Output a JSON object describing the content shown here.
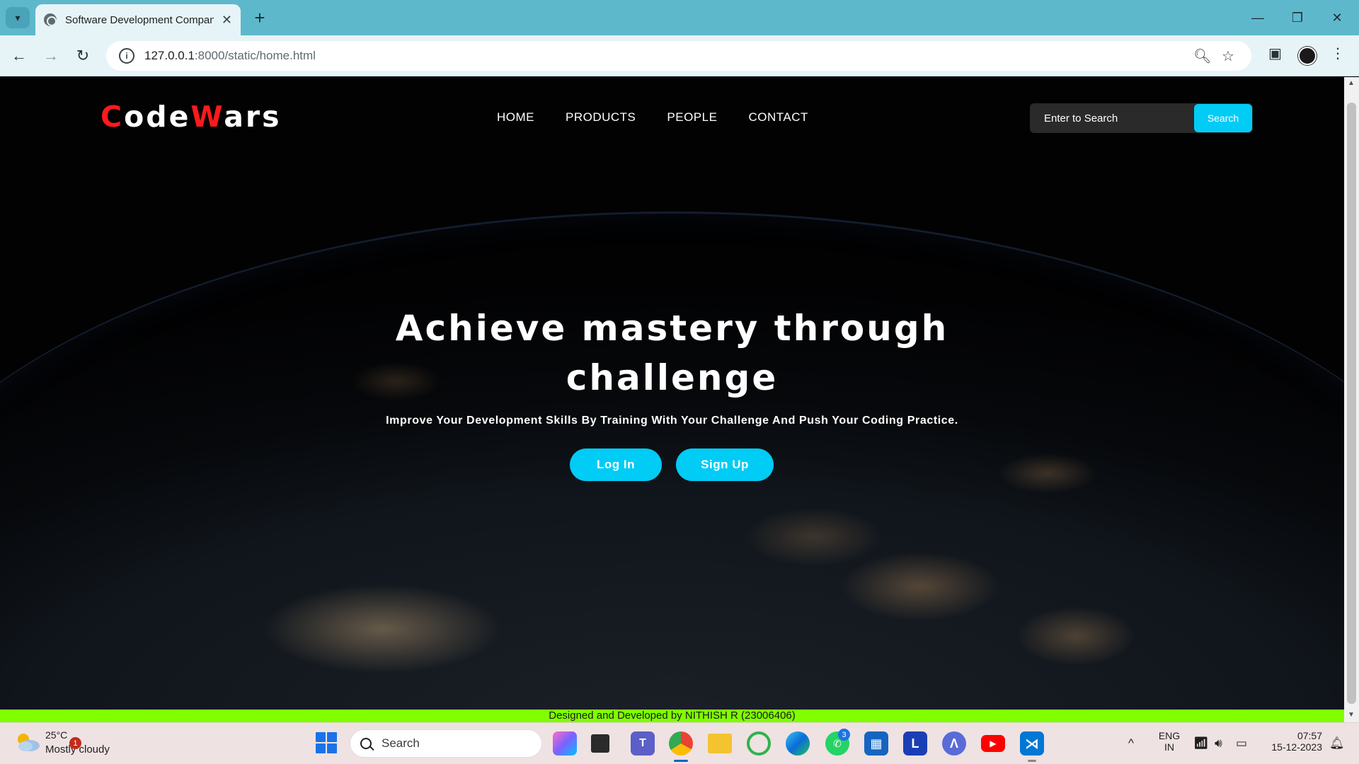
{
  "browser": {
    "tab_title": "Software Development Compan",
    "url_host": "127.0.0.1",
    "url_rest": ":8000/static/home.html"
  },
  "site": {
    "brand": {
      "letter1": "C",
      "part1": "ode",
      "letter2": "W",
      "part2": "ars"
    },
    "nav": [
      "HOME",
      "PRODUCTS",
      "PEOPLE",
      "CONTACT"
    ],
    "search": {
      "placeholder": "Enter to Search",
      "button": "Search"
    },
    "hero": {
      "title_line1": "Achieve mastery through",
      "title_line2": "challenge",
      "subtitle": "Improve Your Development Skills By Training With Your Challenge And Push Your Coding Practice.",
      "login": "Log In",
      "signup": "Sign Up"
    },
    "footer": "Designed and Developed by NITHISH R (23006406)"
  },
  "taskbar": {
    "weather_temp": "25°C",
    "weather_desc": "Mostly cloudy",
    "weather_badge": "1",
    "search": "Search",
    "whatsapp_badge": "3",
    "lang_line1": "ENG",
    "lang_line2": "IN",
    "time": "07:57",
    "date": "15-12-2023"
  },
  "colors": {
    "accent": "#00ccf5",
    "brand_red": "#ff1a1a",
    "footer_green": "#80ff00",
    "chrome_tab": "#5eb8cc"
  }
}
